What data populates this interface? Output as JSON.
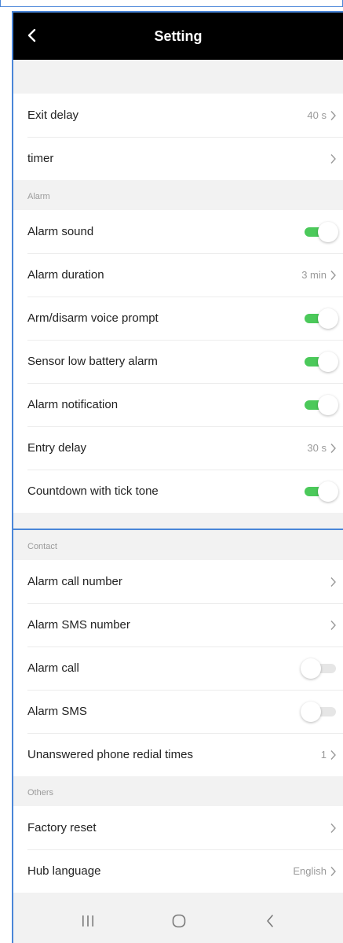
{
  "header": {
    "title": "Setting",
    "back_icon": "chevron-left-icon"
  },
  "sections": {
    "general": {
      "rows": [
        {
          "label": "Exit delay",
          "value": "40 s",
          "type": "link"
        },
        {
          "label": "timer",
          "value": "",
          "type": "link"
        }
      ]
    },
    "alarm": {
      "title": "Alarm",
      "rows": [
        {
          "label": "Alarm sound",
          "type": "toggle",
          "on": true
        },
        {
          "label": "Alarm duration",
          "value": "3 min",
          "type": "link"
        },
        {
          "label": "Arm/disarm voice prompt",
          "type": "toggle",
          "on": true
        },
        {
          "label": "Sensor low battery alarm",
          "type": "toggle",
          "on": true
        },
        {
          "label": "Alarm notification",
          "type": "toggle",
          "on": true
        },
        {
          "label": "Entry delay",
          "value": "30 s",
          "type": "link"
        },
        {
          "label": "Countdown with tick tone",
          "type": "toggle",
          "on": true
        }
      ]
    },
    "contact": {
      "title": "Contact",
      "rows": [
        {
          "label": "Alarm call number",
          "value": "",
          "type": "link"
        },
        {
          "label": "Alarm SMS number",
          "value": "",
          "type": "link"
        },
        {
          "label": "Alarm call",
          "type": "toggle",
          "on": false
        },
        {
          "label": "Alarm SMS",
          "type": "toggle",
          "on": false
        },
        {
          "label": "Unanswered phone redial times",
          "value": "1",
          "type": "link"
        }
      ]
    },
    "others": {
      "title": "Others",
      "rows": [
        {
          "label": "Factory reset",
          "value": "",
          "type": "link"
        },
        {
          "label": "Hub language",
          "value": "English",
          "type": "link"
        }
      ]
    }
  },
  "nav_bar": {
    "recents_icon": "recent-apps-icon",
    "home_icon": "home-icon",
    "back_icon": "back-icon"
  },
  "colors": {
    "header_bg": "#000000",
    "toggle_on": "#4bc95a",
    "toggle_off": "#e6e6e6",
    "page_bg": "#f2f2f2",
    "frame_border": "#4a86d8"
  }
}
